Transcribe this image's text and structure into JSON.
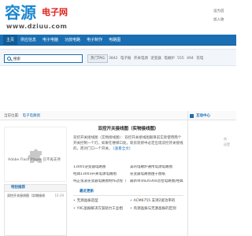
{
  "header": {
    "logo_cn": "容源",
    "logo_suffix": "电子网",
    "logo_url": "www.dziuu.com",
    "links": [
      "设为首",
      "加入收"
    ]
  },
  "nav": {
    "items": [
      "主页",
      "供应信息",
      "电子电脑",
      "功放电路",
      "电子制作",
      "电路图"
    ]
  },
  "search": {
    "value": "搜索",
    "hot_tag_label": "热门TAG",
    "hot_items": [
      "3842",
      "电子报",
      "开关电源",
      "逆变器",
      "电磁炉",
      "555",
      "494",
      "充电"
    ]
  },
  "breadcrumb": {
    "prefix": "当前位置:",
    "path": "电子电路图"
  },
  "flash": {
    "message": "Adobe Flash Player 已不再支持"
  },
  "article": {
    "title": "双控开关接线图（实物接线图）",
    "summary": "双控开关接线图（实物接线图）：双控开关接线图跟目前实际使用两个开关控制一个灯，如果在楼梯口处，新房装修中必定出现双控开关接线的，而对门口一个开关，",
    "more": "[查看全文]"
  },
  "related": [
    "13005逆变器电路图",
    "美的电磁炉通用电源电路图",
    "经典13003开关电源电路图",
    "逆变器电路图由于图纸",
    "纯正弦波逆变器电路图制作过程（",
    "最新单ida2030a音拉电路图|经典"
  ],
  "latest": {
    "title": "最近更新",
    "items": [
      "无源晶振造型",
      "ACM6755 支持2宽功率的",
      "YXC晶振解决方案助力工业相",
      "有源晶振与无源晶振的区别"
    ]
  },
  "special": {
    "title": "特别推荐",
    "rows": [
      {
        "text": "双控开关接线图（实物接线",
        "date": "10-29"
      }
    ]
  },
  "sidebar": {
    "title": "互动中心",
    "rows": [
      "尚",
      "还是"
    ]
  },
  "colors": {
    "brand": "#1a6fb4",
    "logo_blue": "#1b86cf",
    "logo_red": "#e2241e"
  }
}
